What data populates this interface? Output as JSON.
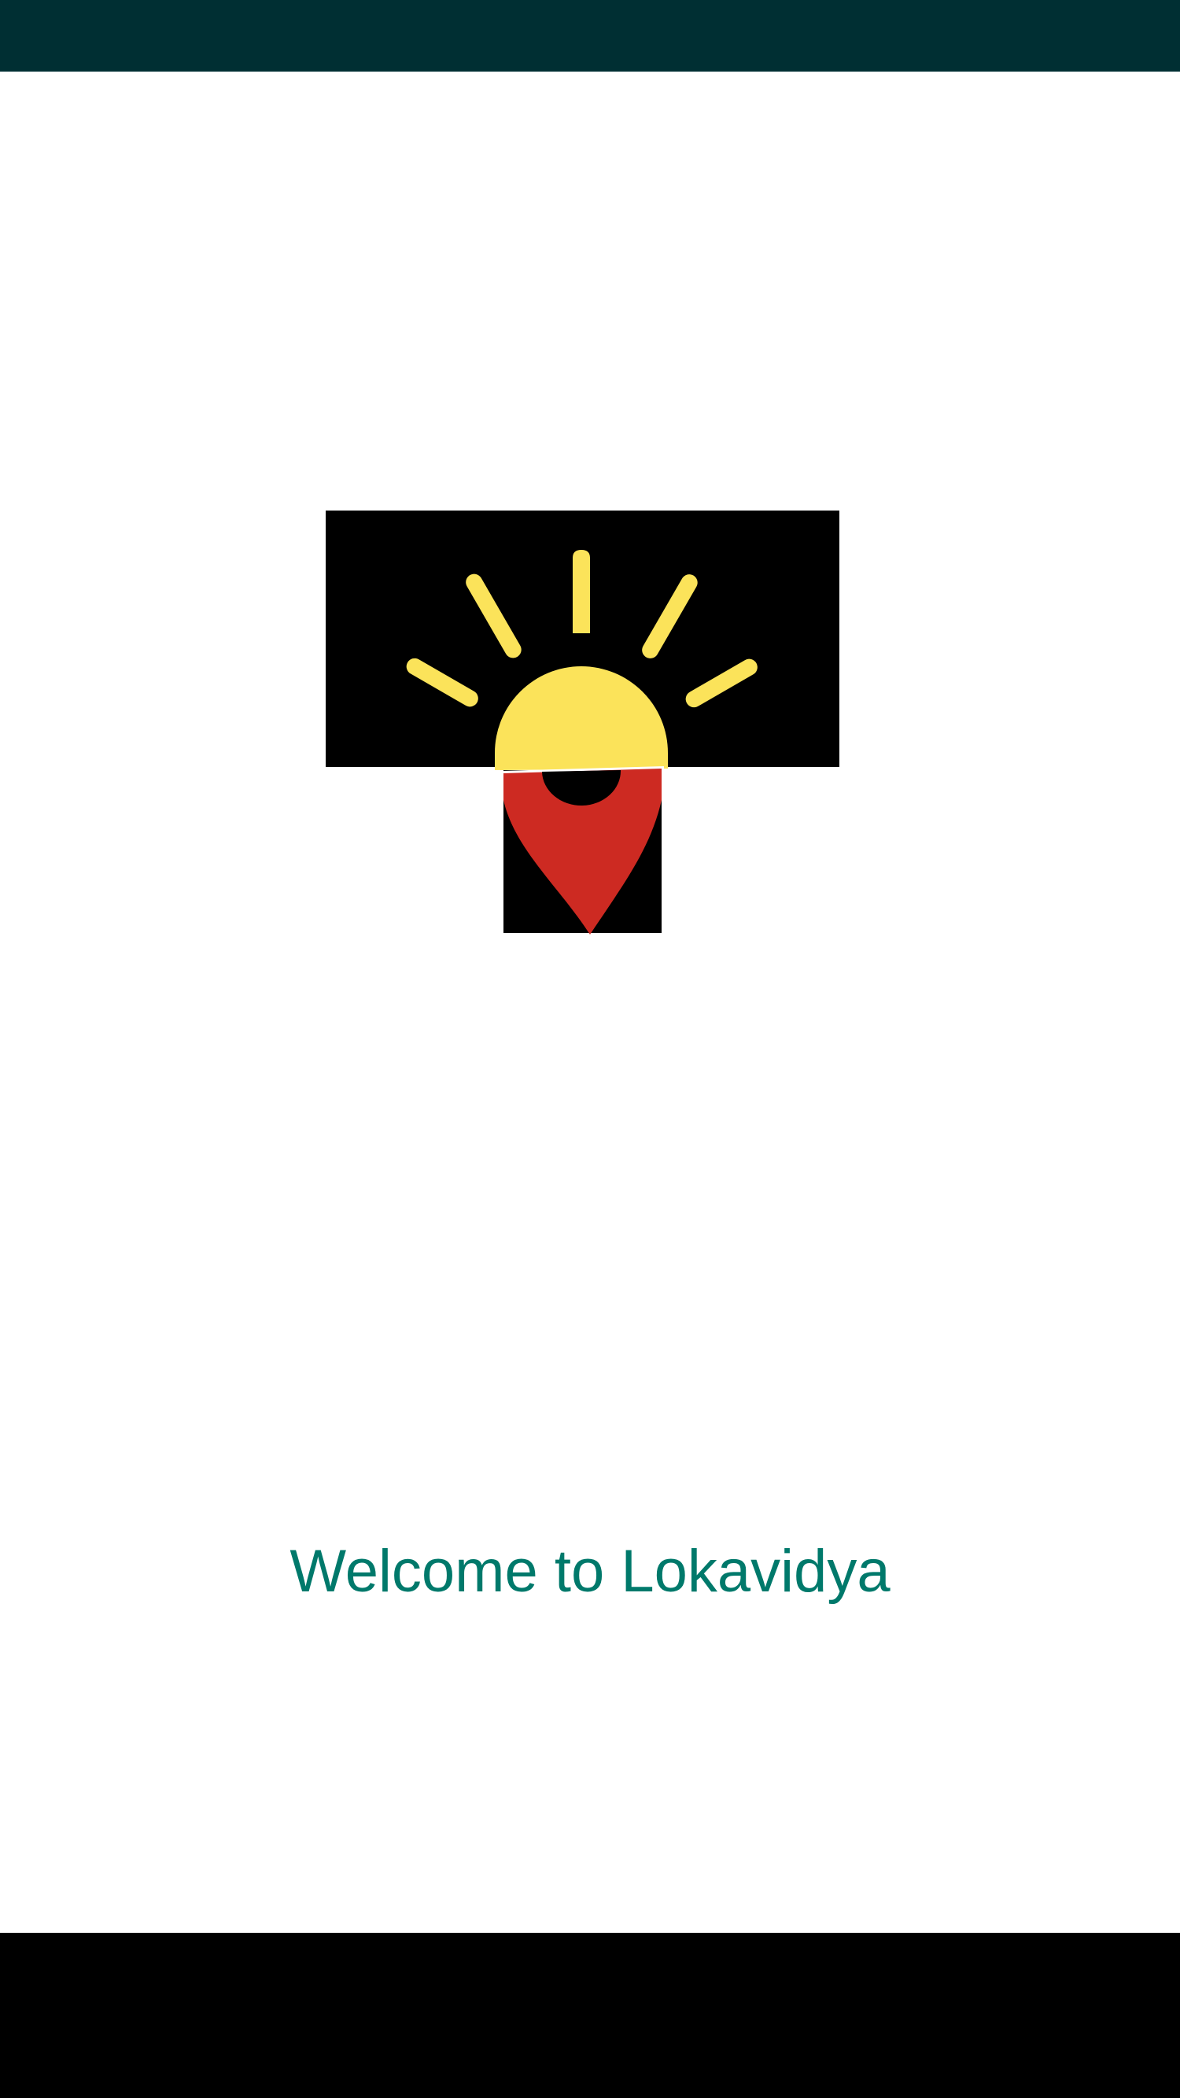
{
  "status_bar": {
    "color": "#002f33"
  },
  "logo": {
    "icon": "lokavidya-sun-map-pin-logo",
    "colors": {
      "background": "#000000",
      "sun": "#fbe35a",
      "pin": "#cd2a22"
    }
  },
  "welcome": {
    "text": "Welcome to Lokavidya",
    "color": "#00796b"
  },
  "nav_bar": {
    "color": "#000000"
  }
}
